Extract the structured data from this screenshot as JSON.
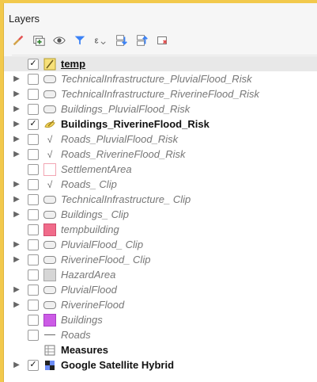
{
  "panel": {
    "title": "Layers"
  },
  "toolbar": {
    "buttons": [
      {
        "name": "open-layer-styling-icon"
      },
      {
        "name": "add-group-icon"
      },
      {
        "name": "manage-visibility-icon"
      },
      {
        "name": "filter-legend-icon"
      },
      {
        "name": "filter-expression-icon"
      },
      {
        "name": "expand-all-icon"
      },
      {
        "name": "collapse-all-icon"
      },
      {
        "name": "remove-layer-icon"
      }
    ]
  },
  "layers": [
    {
      "label": "temp",
      "checked": true,
      "expanded": false,
      "style": "bold-under",
      "icon": "line-yellow",
      "selected": true
    },
    {
      "label": "TechnicalInfrastructure_PluvialFlood_Risk",
      "checked": false,
      "expanded": true,
      "style": "italic",
      "icon": "polygon-gray"
    },
    {
      "label": "TechnicalInfrastructure_RiverineFlood_Risk",
      "checked": false,
      "expanded": true,
      "style": "italic",
      "icon": "polygon-gray"
    },
    {
      "label": "Buildings_PluvialFlood_Risk",
      "checked": false,
      "expanded": true,
      "style": "italic",
      "icon": "polygon-gray"
    },
    {
      "label": "Buildings_RiverineFlood_Risk",
      "checked": true,
      "expanded": true,
      "style": "bold",
      "icon": "polygon-yellow"
    },
    {
      "label": "Roads_PluvialFlood_Risk",
      "checked": false,
      "expanded": true,
      "style": "italic",
      "icon": "line-v"
    },
    {
      "label": "Roads_RiverineFlood_Risk",
      "checked": false,
      "expanded": true,
      "style": "italic",
      "icon": "line-v"
    },
    {
      "label": "SettlementArea",
      "checked": false,
      "expanded": false,
      "style": "italic",
      "icon": "swatch-empty"
    },
    {
      "label": "Roads_ Clip",
      "checked": false,
      "expanded": true,
      "style": "italic",
      "icon": "line-v"
    },
    {
      "label": "TechnicalInfrastructure_ Clip",
      "checked": false,
      "expanded": true,
      "style": "italic",
      "icon": "polygon-gray"
    },
    {
      "label": "Buildings_ Clip",
      "checked": false,
      "expanded": true,
      "style": "italic",
      "icon": "polygon-gray"
    },
    {
      "label": "tempbuilding",
      "checked": false,
      "expanded": false,
      "style": "italic",
      "icon": "swatch-pink"
    },
    {
      "label": "PluvialFlood_ Clip",
      "checked": false,
      "expanded": true,
      "style": "italic",
      "icon": "polygon-gray"
    },
    {
      "label": "RiverineFlood_ Clip",
      "checked": false,
      "expanded": true,
      "style": "italic",
      "icon": "polygon-gray"
    },
    {
      "label": "HazardArea",
      "checked": false,
      "expanded": false,
      "style": "italic",
      "icon": "swatch-gray"
    },
    {
      "label": "PluvialFlood",
      "checked": false,
      "expanded": true,
      "style": "italic",
      "icon": "polygon-gray"
    },
    {
      "label": "RiverineFlood",
      "checked": false,
      "expanded": true,
      "style": "italic",
      "icon": "polygon-gray"
    },
    {
      "label": "Buildings",
      "checked": false,
      "expanded": false,
      "style": "italic",
      "icon": "swatch-violet"
    },
    {
      "label": "Roads",
      "checked": false,
      "expanded": false,
      "style": "italic",
      "icon": "line-plain"
    },
    {
      "label": "Measures",
      "checked": false,
      "expanded": false,
      "style": "bold",
      "icon": "table-icon",
      "nocheckbox": true
    },
    {
      "label": "Google Satellite Hybrid",
      "checked": true,
      "expanded": true,
      "style": "bold",
      "icon": "map-tiles"
    }
  ],
  "colors": {
    "yellow_bg": "#f2c94c",
    "panel_bg": "#f6f6f6"
  }
}
